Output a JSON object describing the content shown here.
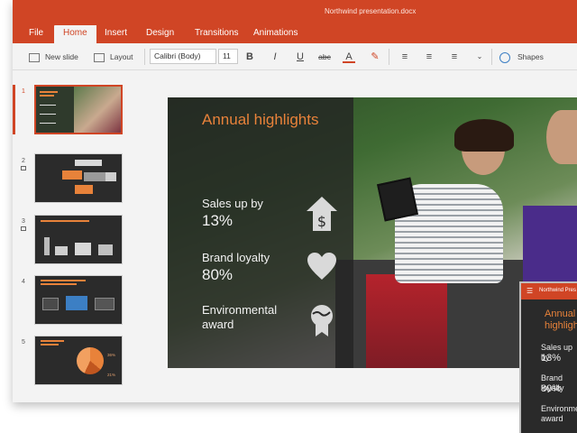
{
  "window": {
    "title": "Northwind presentation.docx"
  },
  "tabs": [
    {
      "label": "File"
    },
    {
      "label": "Home"
    },
    {
      "label": "Insert"
    },
    {
      "label": "Design"
    },
    {
      "label": "Transitions"
    },
    {
      "label": "Animations"
    }
  ],
  "ribbon": {
    "new_slide": "New slide",
    "layout": "Layout",
    "font_name": "Calibri (Body)",
    "font_size": "11",
    "bold": "B",
    "italic": "I",
    "underline": "U",
    "strike": "abc",
    "font_color": "A",
    "shapes": "Shapes"
  },
  "thumbnails": [
    {
      "number": "1",
      "active": true
    },
    {
      "number": "2",
      "active": false,
      "has_comment": true
    },
    {
      "number": "3",
      "active": false,
      "has_comment": true
    },
    {
      "number": "4",
      "active": false
    },
    {
      "number": "5",
      "active": false
    }
  ],
  "thumbnail_text": {
    "slide5_pct_1": "36%",
    "slide5_pct_2": "21%"
  },
  "slide": {
    "title": "Annual highlights",
    "items": [
      {
        "label": "Sales up by",
        "value": "13%",
        "icon": "house-dollar-icon"
      },
      {
        "label": "Brand loyalty",
        "value": "80%",
        "icon": "heart-icon"
      },
      {
        "label": "Environmental award",
        "value": "",
        "icon": "globe-award-icon"
      }
    ]
  },
  "phone": {
    "app_title": "Northwind Pres",
    "title": "Annual highlights",
    "items": [
      {
        "label": "Sales up by",
        "value": "13%"
      },
      {
        "label": "Brand loyalty",
        "value": "80%"
      },
      {
        "label": "Environmental award",
        "value": ""
      }
    ]
  },
  "colors": {
    "accent": "#d04525",
    "slide_title": "#e8823a",
    "panel": "#232323"
  }
}
